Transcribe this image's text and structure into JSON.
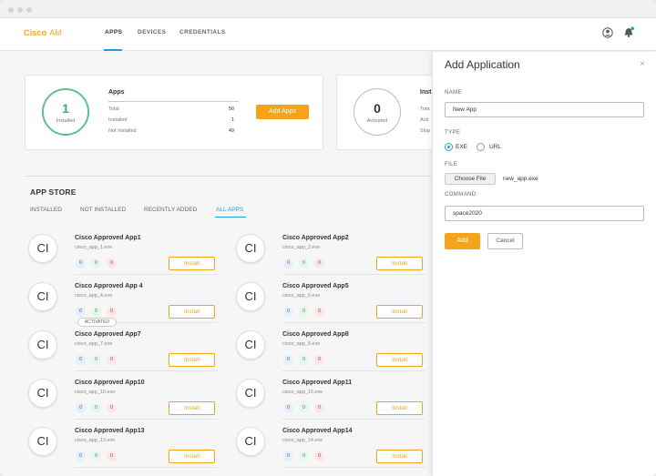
{
  "brand": {
    "primary": "Cisco",
    "secondary": "AM",
    "color": "#f5a31a"
  },
  "nav": {
    "tabs": [
      {
        "label": "APPS",
        "active": true
      },
      {
        "label": "DEVICES"
      },
      {
        "label": "CREDENTIALS"
      }
    ]
  },
  "header_icons": [
    "user-icon",
    "bell-icon"
  ],
  "apps_card": {
    "count": "1",
    "count_label": "Installed",
    "title": "Apps",
    "rows": [
      {
        "label": "Total",
        "value": "50"
      },
      {
        "label": "Installed",
        "value": "1"
      },
      {
        "label": "Not Installed",
        "value": "49"
      }
    ],
    "button": "Add Apps"
  },
  "devices_card": {
    "count": "0",
    "count_label": "Activated",
    "title_partial": "Inst",
    "rows_partial": [
      "Tota",
      "Acti",
      "Slop"
    ]
  },
  "store": {
    "title": "APP STORE",
    "filters": [
      {
        "label": "INSTALLED"
      },
      {
        "label": "NOT INSTALLED"
      },
      {
        "label": "RECENTLY ADDED"
      },
      {
        "label": "ALL APPS",
        "active": true
      }
    ],
    "logo_text": "CI",
    "install_label": "Install",
    "activated_label": "ACTIVATED",
    "apps": [
      {
        "name": "Cisco Approved App1",
        "file": "cisco_app_1.exe",
        "counts": [
          "0",
          "0",
          "0"
        ]
      },
      {
        "name": "Cisco Approved App2",
        "file": "cisco_app_2.exe",
        "counts": [
          "0",
          "0",
          "0"
        ]
      },
      {
        "name": "Cisco Approved App 4",
        "file": "cisco_app_4.exe",
        "counts": [
          "0",
          "0",
          "0"
        ]
      },
      {
        "name": "Cisco Approved App5",
        "file": "cisco_app_5.exe",
        "counts": [
          "0",
          "0",
          "0"
        ]
      },
      {
        "name": "Cisco Approved App7",
        "file": "cisco_app_7.exe",
        "counts": [
          "0",
          "0",
          "0"
        ]
      },
      {
        "name": "Cisco Approved App8",
        "file": "cisco_app_8.exe",
        "counts": [
          "0",
          "0",
          "0"
        ]
      },
      {
        "name": "Cisco Approved App10",
        "file": "cisco_app_10.exe",
        "counts": [
          "0",
          "0",
          "0"
        ]
      },
      {
        "name": "Cisco Approved App11",
        "file": "cisco_app_10.exe",
        "counts": [
          "0",
          "0",
          "0"
        ]
      },
      {
        "name": "Cisco Approved App13",
        "file": "cisco_app_13.exe",
        "counts": [
          "0",
          "0",
          "0"
        ]
      },
      {
        "name": "Cisco Approved App14",
        "file": "cisco_app_14.exe",
        "counts": [
          "0",
          "0",
          "0"
        ]
      }
    ]
  },
  "panel": {
    "title": "Add Application",
    "close": "×",
    "name_label": "NAME",
    "name_value": "New App",
    "type_label": "TYPE",
    "type_options": [
      "EXE",
      "URL"
    ],
    "type_selected": "EXE",
    "file_label": "FILE",
    "choose_file": "Choose File",
    "file_name": "new_app.exe",
    "command_label": "COMMAND",
    "command_value": "space2020",
    "add": "Add",
    "cancel": "Cancel"
  }
}
